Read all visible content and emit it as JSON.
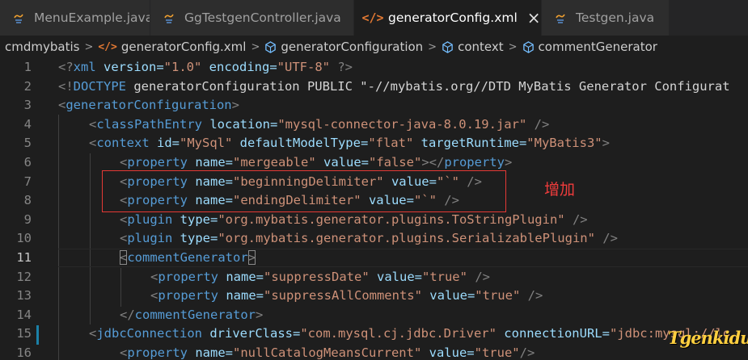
{
  "tabs": [
    {
      "label": "MenuExample.java",
      "icon": "java-file-icon",
      "active": false
    },
    {
      "label": "GgTestgenController.java",
      "icon": "java-file-icon",
      "active": false
    },
    {
      "label": "generatorConfig.xml",
      "icon": "xml-file-icon",
      "active": true
    },
    {
      "label": "Testgen.java",
      "icon": "java-file-icon",
      "active": false
    }
  ],
  "active_tab_close": "×",
  "breadcrumb": [
    "cmdmybatis",
    "generatorConfig.xml",
    "generatorConfiguration",
    "context",
    "commentGenerator"
  ],
  "line_numbers": [
    "1",
    "2",
    "3",
    "4",
    "5",
    "6",
    "7",
    "8",
    "9",
    "10",
    "11",
    "12",
    "13",
    "14",
    "15",
    "16"
  ],
  "current_line": "11",
  "code": {
    "l1": {
      "a": "<?",
      "b": "xml",
      "c": " version=",
      "d": "\"1.0\"",
      "e": " encoding=",
      "f": "\"UTF-8\"",
      "g": " ?>"
    },
    "l2": {
      "a": "<!",
      "b": "DOCTYPE",
      "c": " generatorConfiguration PUBLIC ",
      "d": "\"-//mybatis.org//DTD MyBatis Generator Configurat"
    },
    "l3": {
      "a": "<",
      "b": "generatorConfiguration",
      "c": ">"
    },
    "l4": {
      "a": "<",
      "b": "classPathEntry",
      "c": " location=",
      "d": "\"mysql-connector-java-8.0.19.jar\"",
      "e": " />"
    },
    "l5": {
      "a": "<",
      "b": "context",
      "c": " id=",
      "d": "\"MySql\"",
      "e": " defaultModelType=",
      "f": "\"flat\"",
      "g": " targetRuntime=",
      "h": "\"MyBatis3\"",
      "i": ">"
    },
    "l6": {
      "a": "<",
      "b": "property",
      "c": " name=",
      "d": "\"mergeable\"",
      "e": " value=",
      "f": "\"false\"",
      "g": "></",
      "h": "property",
      "i": ">"
    },
    "l7": {
      "a": "<",
      "b": "property",
      "c": " name=",
      "d": "\"beginningDelimiter\"",
      "e": " value=",
      "f": "\"`\"",
      "g": " />"
    },
    "l8": {
      "a": "<",
      "b": "property",
      "c": " name=",
      "d": "\"endingDelimiter\"",
      "e": " value=",
      "f": "\"`\"",
      "g": " />"
    },
    "l9": {
      "a": "<",
      "b": "plugin",
      "c": " type=",
      "d": "\"org.mybatis.generator.plugins.ToStringPlugin\"",
      "e": " />"
    },
    "l10": {
      "a": "<",
      "b": "plugin",
      "c": " type=",
      "d": "\"org.mybatis.generator.plugins.SerializablePlugin\"",
      "e": " />"
    },
    "l11": {
      "a": "<",
      "b": "commentGenerator",
      "c": ">"
    },
    "l12": {
      "a": "<",
      "b": "property",
      "c": " name=",
      "d": "\"suppressDate\"",
      "e": " value=",
      "f": "\"true\"",
      "g": " />"
    },
    "l13": {
      "a": "<",
      "b": "property",
      "c": " name=",
      "d": "\"suppressAllComments\"",
      "e": " value=",
      "f": "\"true\"",
      "g": " />"
    },
    "l14": {
      "a": "</",
      "b": "commentGenerator",
      "c": ">"
    },
    "l15": {
      "a": "<",
      "b": "jdbcConnection",
      "c": " driverClass=",
      "d": "\"com.mysql.cj.jdbc.Driver\"",
      "e": " connectionURL=",
      "f": "\"jdbc:mysql://lo"
    },
    "l16": {
      "a": "<",
      "b": "property",
      "c": " name=",
      "d": "\"nullCatalogMeansCurrent\"",
      "e": " value=",
      "f": "\"true\"",
      "g": "/>"
    }
  },
  "annotation_text": "增加",
  "watermark": "Tgenkidu",
  "colors": {
    "editor_bg": "#1e1e1e",
    "tag": "#569cd6",
    "attribute": "#9cdcfe",
    "string": "#ce9178",
    "annotation": "#f03c3c",
    "modified_gutter": "#1b81a8"
  }
}
